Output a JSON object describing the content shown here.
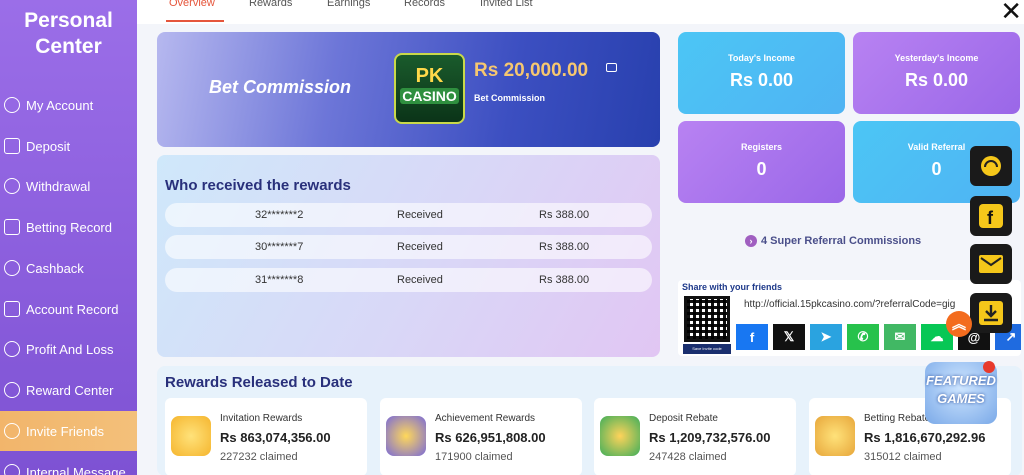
{
  "sidebar": {
    "title_line1": "Personal",
    "title_line2": "Center",
    "items": [
      {
        "label": "My Account",
        "icon": "user-circle-icon"
      },
      {
        "label": "Deposit",
        "icon": "deposit-tag-icon"
      },
      {
        "label": "Withdrawal",
        "icon": "withdrawal-chart-icon"
      },
      {
        "label": "Betting Record",
        "icon": "document-icon"
      },
      {
        "label": "Cashback",
        "icon": "cashback-icon"
      },
      {
        "label": "Account Record",
        "icon": "record-icon"
      },
      {
        "label": "Profit And Loss",
        "icon": "profit-icon"
      },
      {
        "label": "Reward Center",
        "icon": "gear-icon"
      },
      {
        "label": "Invite Friends",
        "icon": "invite-friends-icon"
      },
      {
        "label": "Internal Message",
        "icon": "message-icon"
      }
    ],
    "active_index": 8,
    "active_color": "#f2b56b"
  },
  "tabs": [
    {
      "label": "Overview",
      "active": true
    },
    {
      "label": "Rewards",
      "active": false
    },
    {
      "label": "Earnings",
      "active": false
    },
    {
      "label": "Records",
      "active": false
    },
    {
      "label": "Invited List",
      "active": false
    }
  ],
  "bet_commission": {
    "title": "Bet Commission",
    "logo_top": "PK",
    "logo_bottom": "CASINO",
    "amount": "Rs  20,000.00",
    "sub_label": "Bet Commission"
  },
  "who_received": {
    "title": "Who received the rewards",
    "rows": [
      {
        "user": "32*******2",
        "status": "Received",
        "amount": "Rs  388.00"
      },
      {
        "user": "30*******7",
        "status": "Received",
        "amount": "Rs  388.00"
      },
      {
        "user": "31*******8",
        "status": "Received",
        "amount": "Rs  388.00"
      }
    ]
  },
  "stats": {
    "todays_income": {
      "label": "Today's Income",
      "value": "Rs  0.00"
    },
    "yesterdays_income": {
      "label": "Yesterday's Income",
      "value": "Rs  0.00"
    },
    "registers": {
      "label": "Registers",
      "value": "0"
    },
    "valid_referral": {
      "label": "Valid Referral",
      "value": "0"
    }
  },
  "super_referral": "4 Super Referral Commissions",
  "share": {
    "title": "Share with your friends",
    "url": "http://official.15pkcasino.com/?referralCode=gig",
    "qr_caption": "Save Invite code",
    "socials": [
      {
        "name": "facebook-icon",
        "glyph": "f",
        "color": "#1877f2"
      },
      {
        "name": "x-icon",
        "glyph": "𝕏",
        "color": "#111111"
      },
      {
        "name": "telegram-icon",
        "glyph": "➤",
        "color": "#2aa3e0"
      },
      {
        "name": "whatsapp-icon",
        "glyph": "✆",
        "color": "#27c24c"
      },
      {
        "name": "sms-icon",
        "glyph": "✉",
        "color": "#41b864"
      },
      {
        "name": "line-icon",
        "glyph": "☁",
        "color": "#07c755"
      },
      {
        "name": "threads-icon",
        "glyph": "@",
        "color": "#111111"
      },
      {
        "name": "share-icon",
        "glyph": "↗",
        "color": "#1f6be0"
      }
    ]
  },
  "rewards_released": {
    "title": "Rewards Released to Date",
    "items": [
      {
        "name": "Invitation Rewards",
        "amount": "Rs  863,074,356.00",
        "claimed": "227232 claimed",
        "color": "#f5c542"
      },
      {
        "name": "Achievement Rewards",
        "amount": "Rs  626,951,808.00",
        "claimed": "171900 claimed",
        "color": "#7a6ad8"
      },
      {
        "name": "Deposit Rebate",
        "amount": "Rs  1,209,732,576.00",
        "claimed": "247428 claimed",
        "color": "#3fae5a"
      },
      {
        "name": "Betting Rebate",
        "amount": "Rs  1,816,670,292.96",
        "claimed": "315012 claimed",
        "color": "#e7a63a"
      }
    ]
  },
  "floating": {
    "featured_line1": "FEATURED",
    "featured_line2": "GAMES",
    "buttons": [
      "support-headset-icon",
      "facebook-icon",
      "mail-icon",
      "download-icon"
    ]
  }
}
